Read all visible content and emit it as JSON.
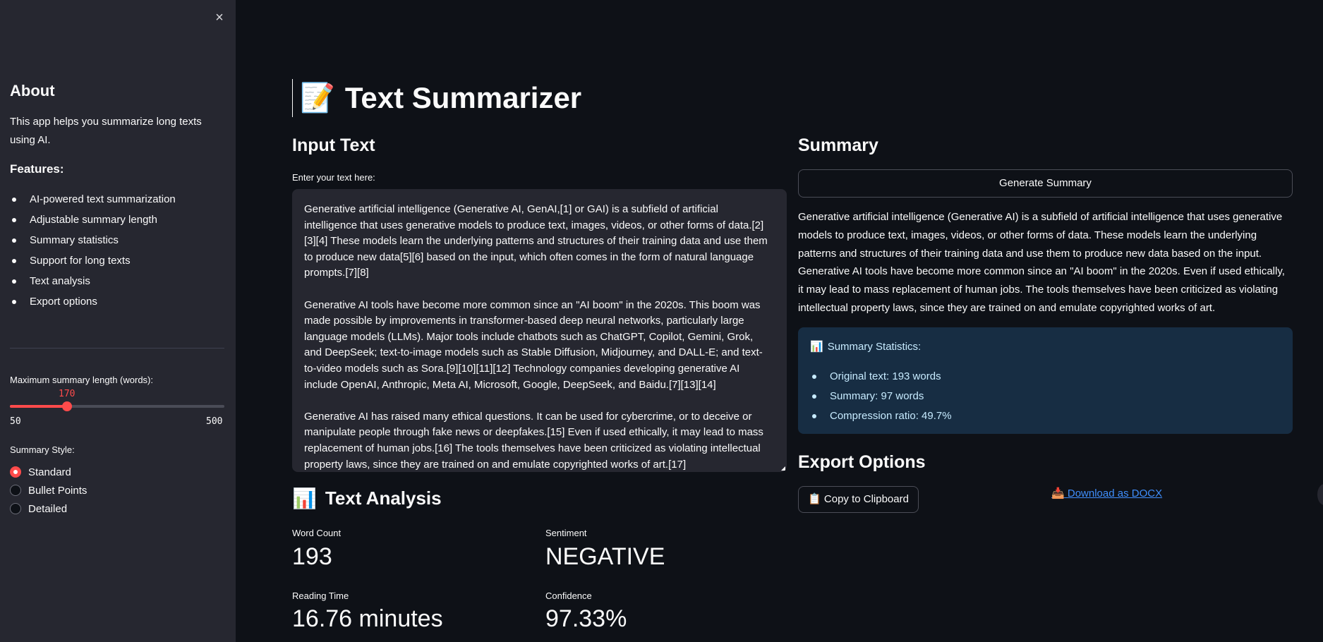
{
  "sidebar": {
    "close_icon": "×",
    "about_title": "About",
    "about_desc": "This app helps you summarize long texts using AI.",
    "features_title": "Features:",
    "features": [
      "AI-powered text summarization",
      "Adjustable summary length",
      "Summary statistics",
      "Support for long texts",
      "Text analysis",
      "Export options"
    ],
    "slider": {
      "label": "Maximum summary length (words):",
      "value": "170",
      "min": "50",
      "max": "500",
      "accent": "#ff4b4b"
    },
    "style": {
      "label": "Summary Style:",
      "options": [
        "Standard",
        "Bullet Points",
        "Detailed"
      ],
      "selected": "Standard"
    }
  },
  "main": {
    "title_icon": "📝",
    "title": "Text Summarizer",
    "input_heading": "Input Text",
    "input_label": "Enter your text here:",
    "input_paragraphs": [
      "Generative artificial intelligence (Generative AI, GenAI,[1] or GAI) is a subfield of artificial intelligence that uses generative models to produce text, images, videos, or other forms of data.[2][3][4] These models learn the underlying patterns and structures of their training data and use them to produce new data[5][6] based on the input, which often comes in the form of natural language prompts.[7][8]",
      "Generative AI tools have become more common since an \"AI boom\" in the 2020s. This boom was made possible by improvements in transformer-based deep neural networks, particularly large language models (LLMs). Major tools include chatbots such as ChatGPT, Copilot, Gemini, Grok, and DeepSeek; text-to-image models such as Stable Diffusion, Midjourney, and DALL-E; and text-to-video models such as Sora.[9][10][11][12] Technology companies developing generative AI include OpenAI, Anthropic, Meta AI, Microsoft, Google, DeepSeek, and Baidu.[7][13][14]",
      "Generative AI has raised many ethical questions. It can be used for cybercrime, or to deceive or manipulate people through fake news or deepfakes.[15] Even if used ethically, it may lead to mass replacement of human jobs.[16] The tools themselves have been criticized as violating intellectual property laws, since they are trained on and emulate copyrighted works of art.[17]"
    ],
    "analysis": {
      "icon": "📊",
      "title": "Text Analysis",
      "metrics": [
        {
          "label": "Word Count",
          "value": "193"
        },
        {
          "label": "Sentiment",
          "value": "NEGATIVE"
        },
        {
          "label": "Reading Time",
          "value": "16.76 minutes"
        },
        {
          "label": "Confidence",
          "value": "97.33%"
        }
      ]
    },
    "summary_heading": "Summary",
    "generate_button": "Generate Summary",
    "summary_text": "Generative artificial intelligence (Generative AI) is a subfield of artificial intelligence that uses generative models to produce text, images, videos, or other forms of data. These models learn the underlying patterns and structures of their training data and use them to produce new data based on the input. Generative AI tools have become more common since an \"AI boom\" in the 2020s. Even if used ethically, it may lead to mass replacement of human jobs. The tools themselves have been criticized as violating intellectual property laws, since they are trained on and emulate copyrighted works of art.",
    "stats": {
      "icon": "📊",
      "title": "Summary Statistics:",
      "items": [
        "Original text: 193 words",
        "Summary: 97 words",
        "Compression ratio: 49.7%"
      ],
      "bg_color": "#172d43",
      "text_color": "#c7ebff"
    },
    "export_heading": "Export Options",
    "copy_button_icon": "📋",
    "copy_button": "Copy to Clipboard",
    "download_icon": "📥",
    "download_link": "Download as DOCX",
    "link_color": "#3f8efc"
  }
}
